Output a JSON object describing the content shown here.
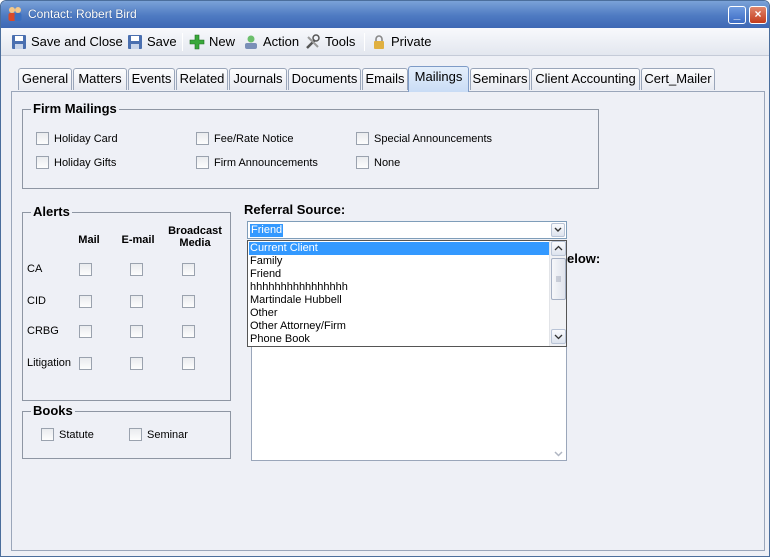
{
  "window": {
    "title": "Contact: Robert Bird",
    "minimize_glyph": "_",
    "close_glyph": "×"
  },
  "toolbar": {
    "save_and_close": "Save and Close",
    "save": "Save",
    "new": "New",
    "action": "Action",
    "tools": "Tools",
    "private": "Private"
  },
  "tabs": [
    "General",
    "Matters",
    "Events",
    "Related",
    "Journals",
    "Documents",
    "Emails",
    "Mailings",
    "Seminars",
    "Client Accounting",
    "Cert_Mailer"
  ],
  "active_tab": "Mailings",
  "firm_mailings": {
    "title": "Firm Mailings",
    "options": [
      "Holiday Card",
      "Holiday Gifts",
      "Fee/Rate Notice",
      "Firm Announcements",
      "Special Announcements",
      "None"
    ]
  },
  "alerts": {
    "title": "Alerts",
    "columns": [
      "Mail",
      "E-mail",
      "Broadcast Media"
    ],
    "rows": [
      "CA",
      "CID",
      "CRBG",
      "Litigation"
    ]
  },
  "books": {
    "title": "Books",
    "options": [
      "Statute",
      "Seminar"
    ]
  },
  "referral": {
    "label": "Referral Source:",
    "selected": "Friend",
    "options": [
      "Current Client",
      "Family",
      "Friend",
      "hhhhhhhhhhhhhhhh",
      "Martindale Hubbell",
      "Other",
      "Other Attorney/Firm",
      "Phone Book"
    ],
    "partial_label_suffix": "elow:"
  },
  "colors": {
    "accent": "#3399ff",
    "title_bar": "#4e7ac2",
    "active_tab": "#c9dcf5"
  }
}
